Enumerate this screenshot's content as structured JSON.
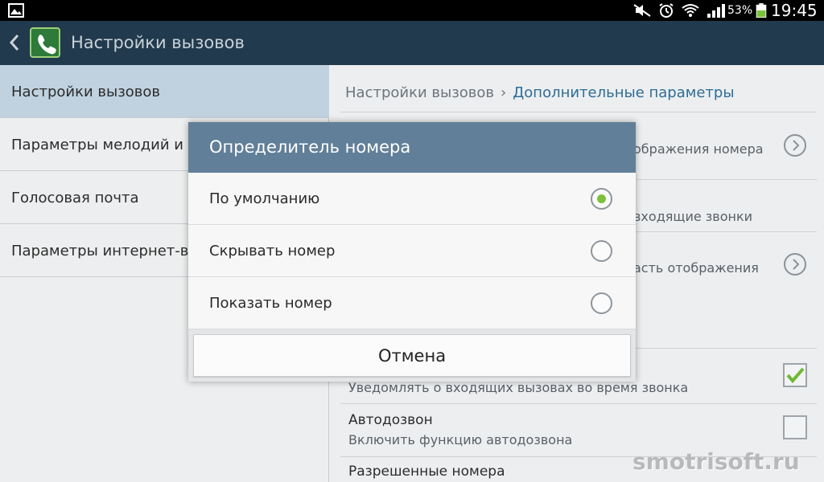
{
  "status_bar": {
    "battery_percent": "53%",
    "time": "19:45",
    "icons": [
      "gallery-icon",
      "mute-icon",
      "alarm-icon",
      "wifi-icon",
      "signal-icon",
      "battery-icon"
    ]
  },
  "action_bar": {
    "title": "Настройки вызовов",
    "icons": [
      "back-icon",
      "phone-settings-icon"
    ]
  },
  "left_menu": {
    "items": [
      {
        "label": "Настройки вызовов",
        "selected": true
      },
      {
        "label": "Параметры мелодий и з",
        "selected": false
      },
      {
        "label": "Голосовая почта",
        "selected": false
      },
      {
        "label": "Параметры интернет-вы",
        "selected": false
      }
    ]
  },
  "right_panel": {
    "breadcrumb": {
      "root": "Настройки вызовов",
      "separator": "›",
      "current": "Дополнительные параметры"
    },
    "visible_text": {
      "item1_sub": "ображения номера",
      "item2_sub": "входящие звонки",
      "item3_sub": "асть отображения",
      "item4_sub": "Уведомлять о входящих вызовах во время звонка",
      "item5_title": "Автодозвон",
      "item5_sub": "Включить функцию автодозвона",
      "item6_title": "Разрешенные номера"
    },
    "checkboxes": {
      "item4_checked": true,
      "item5_checked": false
    }
  },
  "dialog": {
    "title": "Определитель номера",
    "options": [
      {
        "label": "По умолчанию",
        "selected": true
      },
      {
        "label": "Скрывать номер",
        "selected": false
      },
      {
        "label": "Показать номер",
        "selected": false
      }
    ],
    "cancel_label": "Отмена"
  },
  "watermark": "smotrisoft.ru",
  "colors": {
    "action_bar": "#213a4d",
    "dialog_header": "#617f98",
    "selected_item": "#c0d2e0",
    "radio_selected": "#7bc23b",
    "breadcrumb_current": "#2f6d95"
  }
}
